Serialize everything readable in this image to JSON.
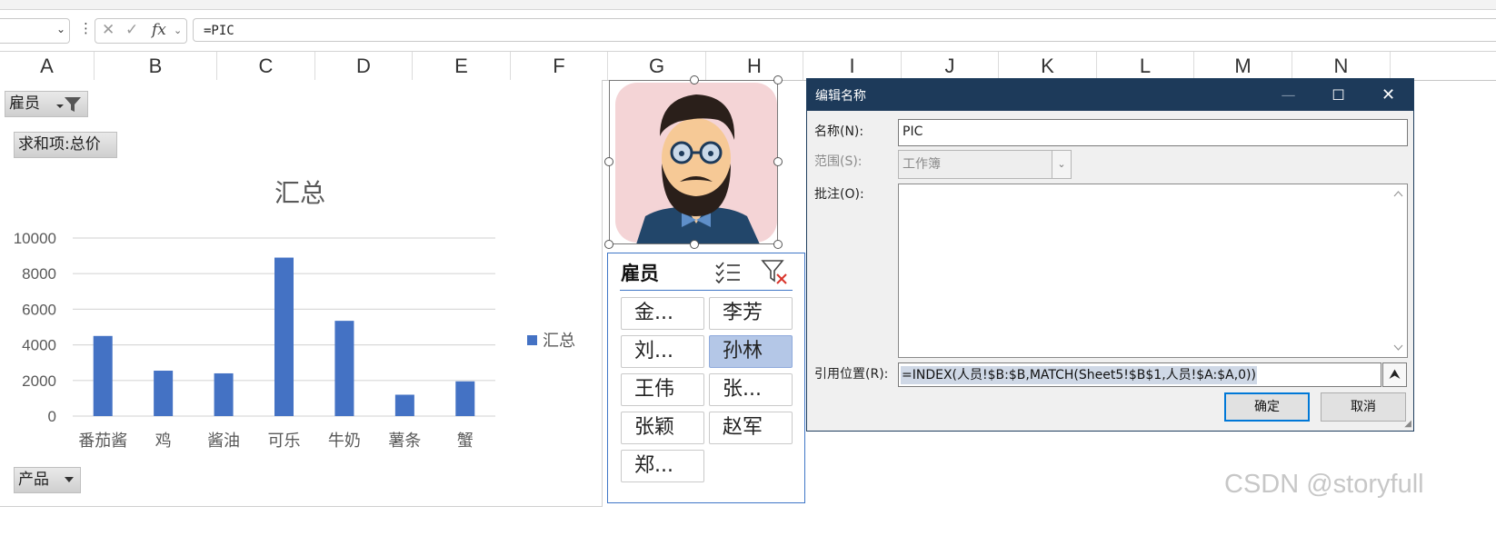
{
  "formula_bar": {
    "name_box_value": "",
    "cancel_icon": "✕",
    "enter_icon": "✓",
    "fx_label": "fx",
    "formula_text": "=PIC"
  },
  "columns": [
    "A",
    "B",
    "C",
    "D",
    "E",
    "F",
    "G",
    "H",
    "I",
    "J",
    "K",
    "L",
    "M",
    "N"
  ],
  "pivot_chart": {
    "filter_field": "雇员",
    "values_field": "求和项:总价",
    "axis_field": "产品",
    "bar_color": "#4472c4"
  },
  "chart_data": {
    "type": "bar",
    "title": "汇总",
    "categories": [
      "番茄酱",
      "鸡",
      "酱油",
      "可乐",
      "牛奶",
      "薯条",
      "蟹"
    ],
    "series": [
      {
        "name": "汇总",
        "values": [
          4500,
          2550,
          2400,
          8900,
          5350,
          1200,
          1950
        ]
      }
    ],
    "ylim": [
      0,
      10000
    ],
    "yticks": [
      0,
      2000,
      4000,
      6000,
      8000,
      10000
    ],
    "grid": true,
    "legend_position": "right"
  },
  "slicer": {
    "title": "雇员",
    "items": [
      {
        "label": "金..."
      },
      {
        "label": "李芳"
      },
      {
        "label": "刘..."
      },
      {
        "label": "孙林",
        "selected": true
      },
      {
        "label": "王伟"
      },
      {
        "label": "张..."
      },
      {
        "label": "张颖"
      },
      {
        "label": "赵军"
      },
      {
        "label": "郑..."
      }
    ]
  },
  "dialog": {
    "title": "编辑名称",
    "name_label": "名称(N):",
    "name_value": "PIC",
    "scope_label": "范围(S):",
    "scope_value": "工作簿",
    "comment_label": "批注(O):",
    "comment_value": "",
    "ref_label": "引用位置(R):",
    "ref_value": "=INDEX(人员!$B:$B,MATCH(Sheet5!$B$1,人员!$A:$A,0))",
    "ok_label": "确定",
    "cancel_label": "取消"
  },
  "watermark": "CSDN @storyfull"
}
